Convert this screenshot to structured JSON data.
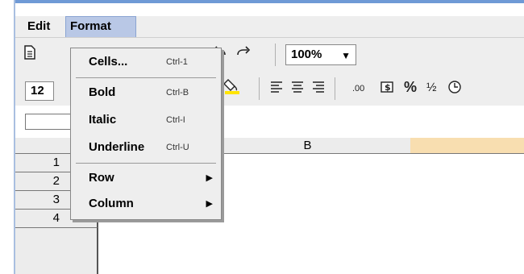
{
  "menubar": {
    "edit_label": "Edit",
    "format_label": "Format"
  },
  "toolbar": {
    "zoom_value": "100%",
    "font_size_value": "12",
    "decimals_label": ".00",
    "percent_label": "%",
    "fraction_label": "½"
  },
  "format_menu": {
    "items": [
      {
        "label": "Cells...",
        "shortcut": "Ctrl-1"
      },
      {
        "label": "Bold",
        "shortcut": "Ctrl-B"
      },
      {
        "label": "Italic",
        "shortcut": "Ctrl-I"
      },
      {
        "label": "Underline",
        "shortcut": "Ctrl-U"
      },
      {
        "label": "Row",
        "submenu": true
      },
      {
        "label": "Column",
        "submenu": true
      }
    ]
  },
  "grid": {
    "columns": [
      "B"
    ],
    "rows": [
      "1",
      "2",
      "3",
      "4"
    ]
  },
  "icons": [
    "new-document-icon",
    "undo-icon",
    "redo-icon",
    "fill-color-icon",
    "align-left-icon",
    "align-center-icon",
    "align-right-icon",
    "currency-icon",
    "clock-icon"
  ]
}
